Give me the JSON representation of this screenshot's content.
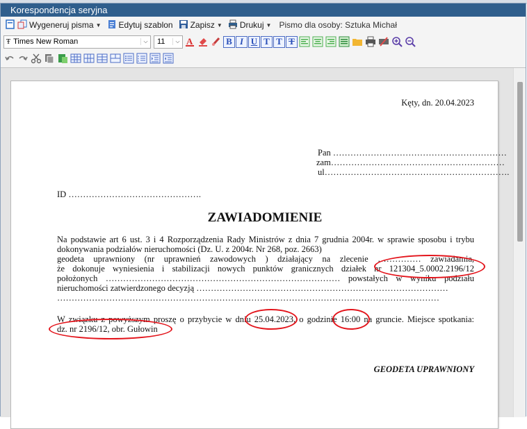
{
  "window": {
    "title": "Korespondencja seryjna"
  },
  "menu": {
    "generate": "Wygeneruj pisma",
    "edit_template": "Edytuj szablon",
    "save": "Zapisz",
    "print": "Drukuj",
    "person_label": "Pismo dla osoby: Sztuka Michał"
  },
  "format": {
    "font": "Times New Roman",
    "size": "11",
    "bold": "B",
    "italic": "I",
    "underline": "U",
    "superscript": "T",
    "subscript": "T",
    "strike": "T"
  },
  "doc": {
    "place_date": "Kęty, dn. 20.04.2023",
    "pan": "Pan ……………………………………………………",
    "zam": "zam……………………………………………………",
    "ul": "ul……………………………………………………….",
    "id": "ID ……………………………………….",
    "heading": "ZAWIADOMIENIE",
    "para1_l1": "Na podstawie art 6 ust. 3 i 4 Rozporządzenia Rady Ministrów z dnia 7 grudnia 2004r. w sprawie sposobu i trybu",
    "para1_l2": "dokonywania podziałów nieruchomości (Dz. U. z 2004r. Nr 268, poz. 2663)",
    "para1_l3": "geodeta uprawniony (nr uprawnień zawodowych                    ) działający na zlecenie …………… zawiadamia,",
    "para1_l4": "że dokonuje wyniesienia i stabilizacji nowych punktów granicznych działek nr 121304_5.0002.2196/12",
    "para1_l5": "położonych ……………………………………………………………………… powstałych w wyniku podziału",
    "para1_l6": "nieruchomości zatwierdzonego decyzją ……………………………………………………………………………",
    "para1_l7": "……………………………………………………………………………………………………………………",
    "para2_l1": "W związku z powyższym proszę o przybycie w dniu 25.04.2023, o godzinie 16:00 na gruncie. Miejsce spotkania:",
    "para2_l2": "dz. nr 2196/12, obr. Gułowin",
    "signature": "GEODETA UPRAWNIONY"
  },
  "colors": {
    "titlebar": "#2f5e8c",
    "annotation": "#e3141b"
  }
}
